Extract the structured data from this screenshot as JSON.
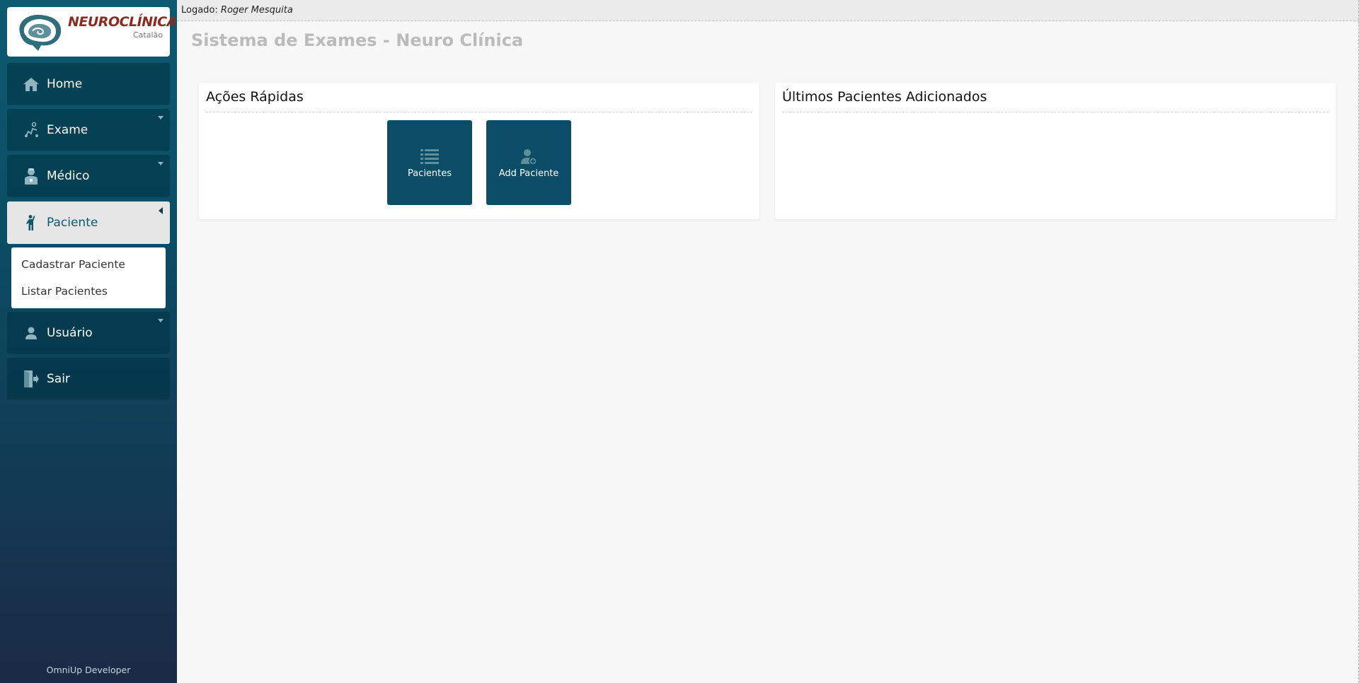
{
  "brand": {
    "name": "NEUROCLÍNICA",
    "subtitle": "Catalão",
    "colors": {
      "sidebar": "#0b4d63",
      "accent": "#0b4d66",
      "logo_text": "#8c2a22"
    }
  },
  "sidebar": {
    "items": [
      {
        "label": "Home",
        "icon": "home-icon"
      },
      {
        "label": "Exame",
        "icon": "exam-icon"
      },
      {
        "label": "Médico",
        "icon": "doctor-icon"
      },
      {
        "label": "Paciente",
        "icon": "patient-icon"
      },
      {
        "label": "Usuário",
        "icon": "user-icon"
      },
      {
        "label": "Sair",
        "icon": "logout-icon"
      }
    ],
    "submenu": [
      {
        "label": "Cadastrar Paciente"
      },
      {
        "label": "Listar Pacientes"
      }
    ],
    "footer": "OmniUp Developer"
  },
  "topbar": {
    "prefix": "Logado:",
    "user": "Roger Mesquita"
  },
  "page": {
    "title": "Sistema de Exames - Neuro Clínica"
  },
  "quick_actions": {
    "title": "Ações Rápidas",
    "tiles": [
      {
        "label": "Pacientes",
        "icon": "list-icon"
      },
      {
        "label": "Add Paciente",
        "icon": "add-patient-icon"
      }
    ]
  },
  "recent_patients": {
    "title": "Últimos Pacientes Adicionados"
  }
}
